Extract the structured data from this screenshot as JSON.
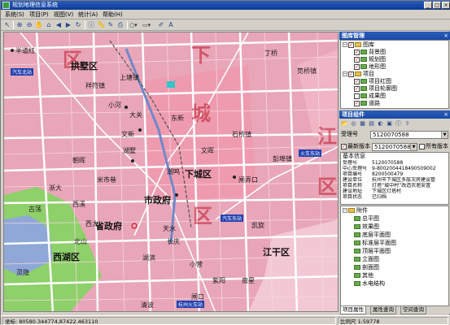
{
  "window": {
    "title": "规划地理信息系统"
  },
  "menu": [
    "系统(S)",
    "项目(P)",
    "视图(V)",
    "统计(A)",
    "帮助(H)"
  ],
  "toolbar": {
    "icons": [
      "select-icon",
      "zoom-in-icon",
      "zoom-out-icon",
      "pan-icon",
      "full-extent-icon",
      "back-icon",
      "forward-icon",
      "refresh-icon",
      "identify-icon",
      "measure-icon",
      "draw-icon",
      "print-icon"
    ],
    "dropdown_icons": [
      "draw-circle-dropdown",
      "draw-shape-dropdown"
    ]
  },
  "map": {
    "districts": [
      "拱墅区",
      "下城区",
      "西湖区",
      "江干区",
      "市政府",
      "省政府"
    ],
    "big_labels": [
      "下",
      "城",
      "区",
      "江",
      "区",
      "区"
    ],
    "places": [
      "半道红",
      "上塘镇",
      "祥符镇",
      "小河",
      "大关",
      "东新",
      "湖墅",
      "石桥镇",
      "文晖",
      "彭埠镇",
      "米市巷",
      "潮鸣",
      "朝晖",
      "闸弄口",
      "西溪",
      "古荡",
      "北山",
      "灵隐",
      "天水",
      "长庆",
      "湖滨",
      "小营",
      "凯旋",
      "南星",
      "闸口",
      "紫阳",
      "清波",
      "笕桥镇",
      "丁桥",
      "文新",
      "浙大",
      "西大",
      "汽车北站",
      "火车东站",
      "杭州火车站"
    ],
    "bus_tags": [
      "汽车北站",
      "火车东站",
      "汽车东站",
      "杭州火车站"
    ]
  },
  "layer_panel": {
    "title": "图库管理",
    "items": [
      {
        "label": "图库",
        "level": 0,
        "checked": true,
        "type": "folder"
      },
      {
        "label": "背景图",
        "level": 1,
        "checked": true,
        "type": "layer"
      },
      {
        "label": "规划图",
        "level": 1,
        "checked": true,
        "type": "layer"
      },
      {
        "label": "地形图",
        "level": 1,
        "checked": true,
        "type": "layer"
      },
      {
        "label": "项目",
        "level": 0,
        "checked": true,
        "type": "folder"
      },
      {
        "label": "项目红图",
        "level": 1,
        "checked": true,
        "type": "layer"
      },
      {
        "label": "项目轮廓图",
        "level": 1,
        "checked": true,
        "type": "layer"
      },
      {
        "label": "成果图",
        "level": 1,
        "checked": false,
        "type": "layer"
      },
      {
        "label": "道路",
        "level": 1,
        "checked": true,
        "type": "layer"
      }
    ]
  },
  "project_panel": {
    "title": "项目组件",
    "record_label": "受理号",
    "record_value": "5120070588",
    "latest_label": "最新版本",
    "latest_value": "5120070588_1",
    "all_label": "所有版本",
    "info_header": "基本信息",
    "info": [
      {
        "k": "受理号",
        "v": "5120070588"
      },
      {
        "k": "中心受理号",
        "v": "9-8002004418490509002"
      },
      {
        "k": "项目编号",
        "v": "8200500479"
      },
      {
        "k": "建设单位",
        "v": "杭州市下城区多层次房建设管"
      },
      {
        "k": "项目名称",
        "v": "灯塔“城中村”改造农居安置"
      },
      {
        "k": "建设地址",
        "v": "下城区灯塔村"
      },
      {
        "k": "项目状态",
        "v": "已归档"
      }
    ],
    "attach_header": "附件",
    "attachments": [
      "总平图",
      "效果图",
      "底层平面图",
      "标准层平面图",
      "顶层平面图",
      "立面图",
      "剖面图",
      "其他",
      "水电结构"
    ]
  },
  "bottom_tabs": [
    "项目属性",
    "属性查询",
    "空间查询"
  ],
  "status": {
    "coords": "坐标: 80580.344774,87422.463110",
    "scale": "比例尺 1:59778"
  },
  "colors": {
    "map_bg": "#e8a6b8",
    "road": "#ffffff",
    "water": "#8fa8d8",
    "park": "#8ed06a",
    "title_bar": "#0a3a9a"
  }
}
